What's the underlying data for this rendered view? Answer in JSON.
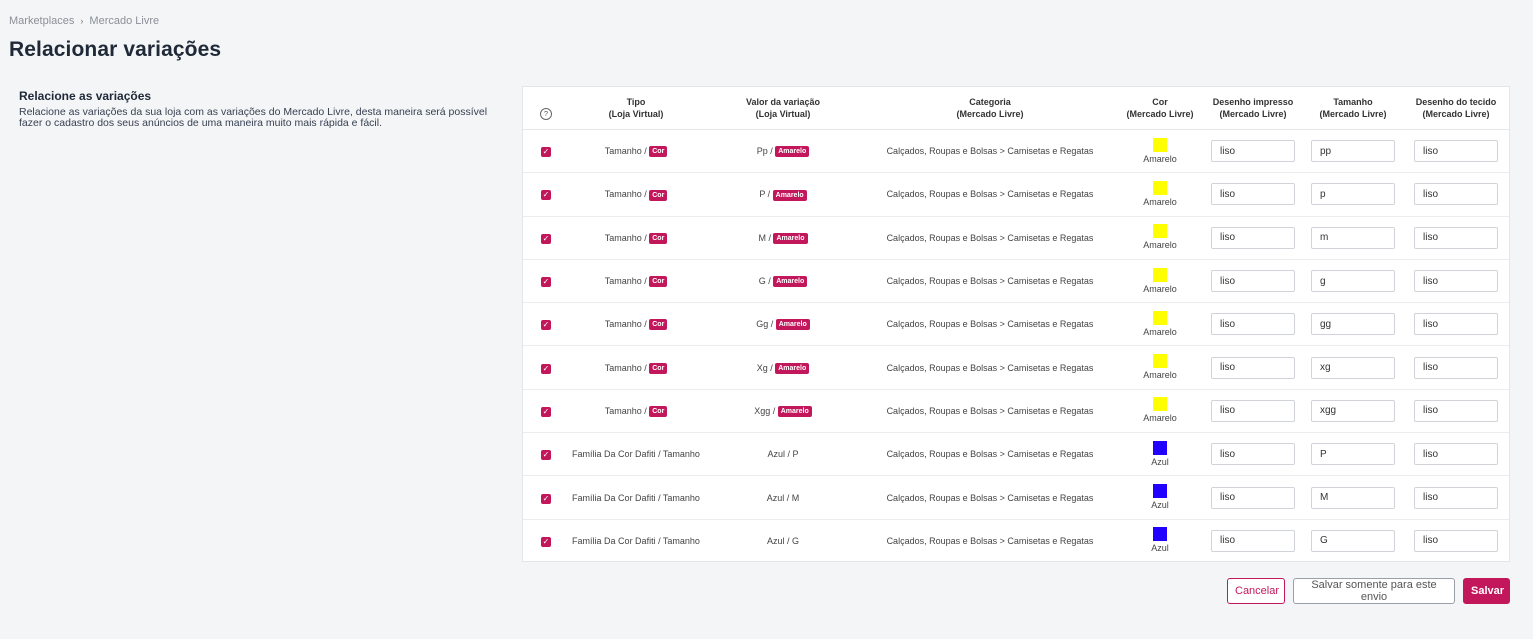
{
  "breadcrumb": {
    "items": [
      "Marketplaces",
      "Mercado Livre"
    ],
    "separator": "›"
  },
  "page_title": "Relacionar variações",
  "intro": {
    "heading": "Relacione as variações",
    "text": "Relacione as variações da sua loja com as variações do Mercado Livre, desta maneira será possível fazer o cadastro dos seus anúncios de uma maneira muito mais rápida e fácil."
  },
  "table": {
    "help_glyph": "?",
    "headers": {
      "tipo": {
        "line1": "Tipo",
        "line2": "(Loja Virtual)"
      },
      "valor": {
        "line1": "Valor da variação",
        "line2": "(Loja Virtual)"
      },
      "categoria": {
        "line1": "Categoria",
        "line2": "(Mercado Livre)"
      },
      "cor": {
        "line1": "Cor",
        "line2": "(Mercado Livre)"
      },
      "desenho_impresso": {
        "line1": "Desenho impresso",
        "line2": "(Mercado Livre)"
      },
      "tamanho": {
        "line1": "Tamanho",
        "line2": "(Mercado Livre)"
      },
      "desenho_tecido": {
        "line1": "Desenho do tecido",
        "line2": "(Mercado Livre)"
      }
    },
    "rows": [
      {
        "checked": true,
        "tipo_text": "Tamanho / ",
        "tipo_tag": "Cor",
        "valor_text": "Pp / ",
        "valor_tag": "Amarelo",
        "categoria": "Calçados, Roupas e Bolsas > Camisetas e Regatas",
        "color_name": "Amarelo",
        "color_hex": "#ffff00",
        "desenho_impresso": "liso",
        "tamanho": "pp",
        "desenho_tecido": "liso"
      },
      {
        "checked": true,
        "tipo_text": "Tamanho / ",
        "tipo_tag": "Cor",
        "valor_text": "P / ",
        "valor_tag": "Amarelo",
        "categoria": "Calçados, Roupas e Bolsas > Camisetas e Regatas",
        "color_name": "Amarelo",
        "color_hex": "#ffff00",
        "desenho_impresso": "liso",
        "tamanho": "p",
        "desenho_tecido": "liso"
      },
      {
        "checked": true,
        "tipo_text": "Tamanho / ",
        "tipo_tag": "Cor",
        "valor_text": "M / ",
        "valor_tag": "Amarelo",
        "categoria": "Calçados, Roupas e Bolsas > Camisetas e Regatas",
        "color_name": "Amarelo",
        "color_hex": "#ffff00",
        "desenho_impresso": "liso",
        "tamanho": "m",
        "desenho_tecido": "liso"
      },
      {
        "checked": true,
        "tipo_text": "Tamanho / ",
        "tipo_tag": "Cor",
        "valor_text": "G / ",
        "valor_tag": "Amarelo",
        "categoria": "Calçados, Roupas e Bolsas > Camisetas e Regatas",
        "color_name": "Amarelo",
        "color_hex": "#ffff00",
        "desenho_impresso": "liso",
        "tamanho": "g",
        "desenho_tecido": "liso"
      },
      {
        "checked": true,
        "tipo_text": "Tamanho / ",
        "tipo_tag": "Cor",
        "valor_text": "Gg / ",
        "valor_tag": "Amarelo",
        "categoria": "Calçados, Roupas e Bolsas > Camisetas e Regatas",
        "color_name": "Amarelo",
        "color_hex": "#ffff00",
        "desenho_impresso": "liso",
        "tamanho": "gg",
        "desenho_tecido": "liso"
      },
      {
        "checked": true,
        "tipo_text": "Tamanho / ",
        "tipo_tag": "Cor",
        "valor_text": "Xg / ",
        "valor_tag": "Amarelo",
        "categoria": "Calçados, Roupas e Bolsas > Camisetas e Regatas",
        "color_name": "Amarelo",
        "color_hex": "#ffff00",
        "desenho_impresso": "liso",
        "tamanho": "xg",
        "desenho_tecido": "liso"
      },
      {
        "checked": true,
        "tipo_text": "Tamanho / ",
        "tipo_tag": "Cor",
        "valor_text": "Xgg / ",
        "valor_tag": "Amarelo",
        "categoria": "Calçados, Roupas e Bolsas > Camisetas e Regatas",
        "color_name": "Amarelo",
        "color_hex": "#ffff00",
        "desenho_impresso": "liso",
        "tamanho": "xgg",
        "desenho_tecido": "liso"
      },
      {
        "checked": true,
        "tipo_text": "Família Da Cor Dafiti / Tamanho",
        "tipo_tag": "",
        "valor_text": "Azul / P",
        "valor_tag": "",
        "categoria": "Calçados, Roupas e Bolsas > Camisetas e Regatas",
        "color_name": "Azul",
        "color_hex": "#2200ff",
        "desenho_impresso": "liso",
        "tamanho": "P",
        "desenho_tecido": "liso"
      },
      {
        "checked": true,
        "tipo_text": "Família Da Cor Dafiti / Tamanho",
        "tipo_tag": "",
        "valor_text": "Azul / M",
        "valor_tag": "",
        "categoria": "Calçados, Roupas e Bolsas > Camisetas e Regatas",
        "color_name": "Azul",
        "color_hex": "#2200ff",
        "desenho_impresso": "liso",
        "tamanho": "M",
        "desenho_tecido": "liso"
      },
      {
        "checked": true,
        "tipo_text": "Família Da Cor Dafiti / Tamanho",
        "tipo_tag": "",
        "valor_text": "Azul / G",
        "valor_tag": "",
        "categoria": "Calçados, Roupas e Bolsas > Camisetas e Regatas",
        "color_name": "Azul",
        "color_hex": "#2200ff",
        "desenho_impresso": "liso",
        "tamanho": "G",
        "desenho_tecido": "liso"
      }
    ]
  },
  "actions": {
    "cancel": "Cancelar",
    "save_once": "Salvar somente para este envio",
    "save": "Salvar"
  },
  "colors": {
    "accent": "#c2185b"
  }
}
